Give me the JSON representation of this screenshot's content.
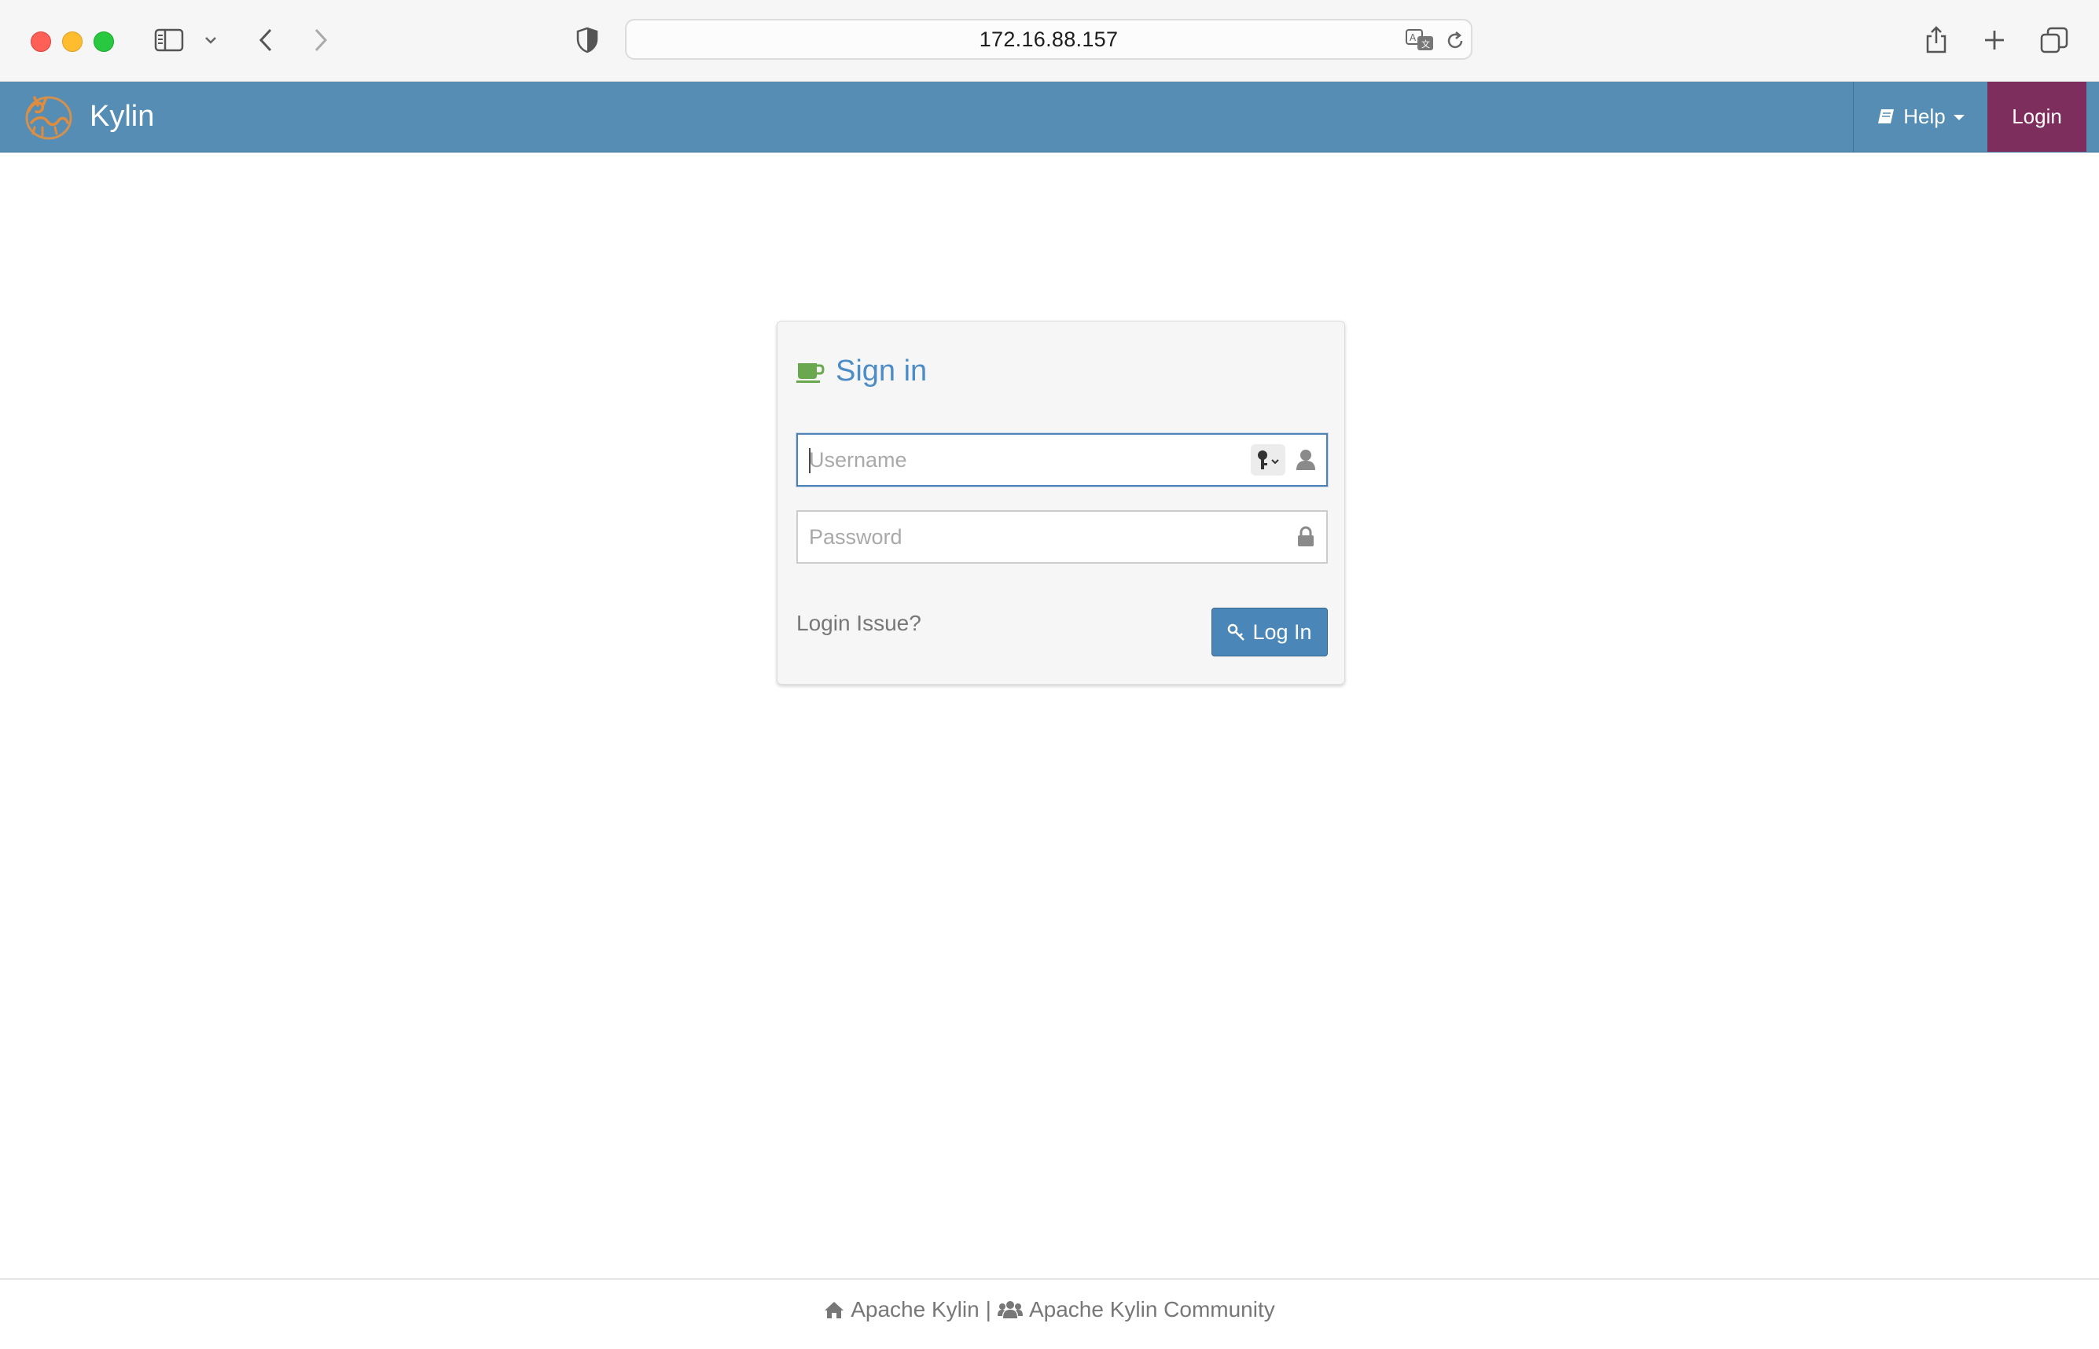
{
  "browser": {
    "url": "172.16.88.157",
    "icons": [
      "sidebar-icon",
      "chevron-down-icon",
      "back-icon",
      "forward-icon",
      "shield-icon",
      "translate-icon",
      "reload-icon",
      "share-icon",
      "plus-icon",
      "tabs-icon"
    ]
  },
  "navbar": {
    "brand": "Kylin",
    "help_label": "Help",
    "login_label": "Login",
    "colors": {
      "bar": "#558db4",
      "login_bg": "#7e2e5c"
    }
  },
  "signin": {
    "title": "Sign in",
    "username_placeholder": "Username",
    "password_placeholder": "Password",
    "login_issue_label": "Login Issue?",
    "login_button_label": "Log In",
    "colors": {
      "title": "#4c8cc7",
      "button": "#4a86b8",
      "coffee_icon": "#6aa84f"
    }
  },
  "footer": {
    "apache_kylin": "Apache Kylin",
    "separator": "|",
    "community": "Apache Kylin Community"
  }
}
